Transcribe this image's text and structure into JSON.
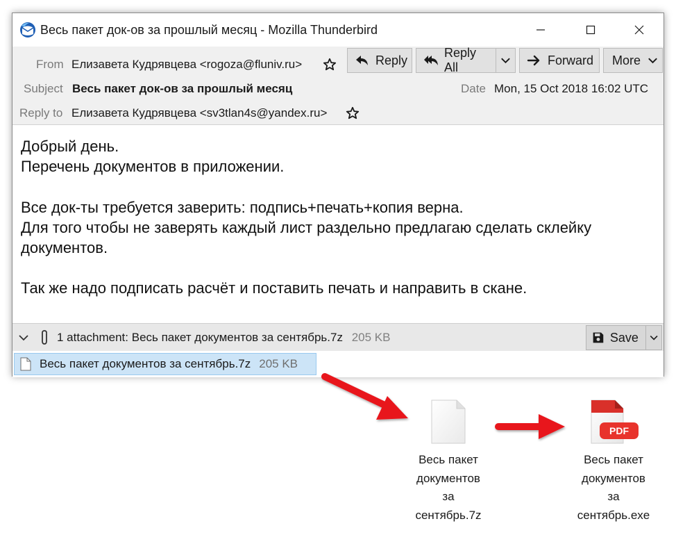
{
  "window": {
    "title": "Весь пакет док-ов за прошлый месяц - Mozilla Thunderbird"
  },
  "header": {
    "from_label": "From",
    "from_value": "Елизавета Кудрявцева <rogoza@fluniv.ru>",
    "subject_label": "Subject",
    "subject_value": "Весь пакет док-ов за прошлый месяц",
    "date_label": "Date",
    "date_value": "Mon, 15 Oct 2018 16:02 UTC",
    "replyto_label": "Reply to",
    "replyto_value": "Елизавета Кудрявцева <sv3tlan4s@yandex.ru>"
  },
  "toolbar": {
    "reply_label": "Reply",
    "reply_all_label": "Reply All",
    "forward_label": "Forward",
    "more_label": "More"
  },
  "message": {
    "lines": [
      "Добрый день.",
      "Перечень документов в приложении.",
      "Все док-ты требуется заверить: подпись+печать+копия верна.",
      "Для того чтобы не заверять каждый лист раздельно предлагаю сделать склейку",
      "документов.",
      "Так же надо подписать расчёт и поставить печать и направить в скане."
    ]
  },
  "attachments": {
    "summary": "1 attachment: Весь пакет документов за сентябрь.7z",
    "summary_size": "205 KB",
    "save_label": "Save",
    "items": [
      {
        "name": "Весь пакет документов за сентябрь.7z",
        "size": "205 KB"
      }
    ]
  },
  "illustration": {
    "archive_label": [
      "Весь пакет",
      "документов",
      "за",
      "сентябрь.7z"
    ],
    "exe_label": [
      "Весь пакет",
      "документов",
      "за",
      "сентябрь.exe"
    ],
    "pdf_badge": "PDF"
  },
  "colors": {
    "arrow": "#e8161c",
    "selection": "#cce4f7",
    "header_bg": "#f0f0f0",
    "pdf_red": "#e8332c"
  },
  "icons": {
    "app": "thunderbird-logo-icon",
    "reply": "reply-arrow-icon",
    "reply_all": "reply-all-arrow-icon",
    "forward": "forward-arrow-icon",
    "star": "star-outline-icon",
    "attachment": "paperclip-icon",
    "save": "floppy-disk-icon"
  }
}
